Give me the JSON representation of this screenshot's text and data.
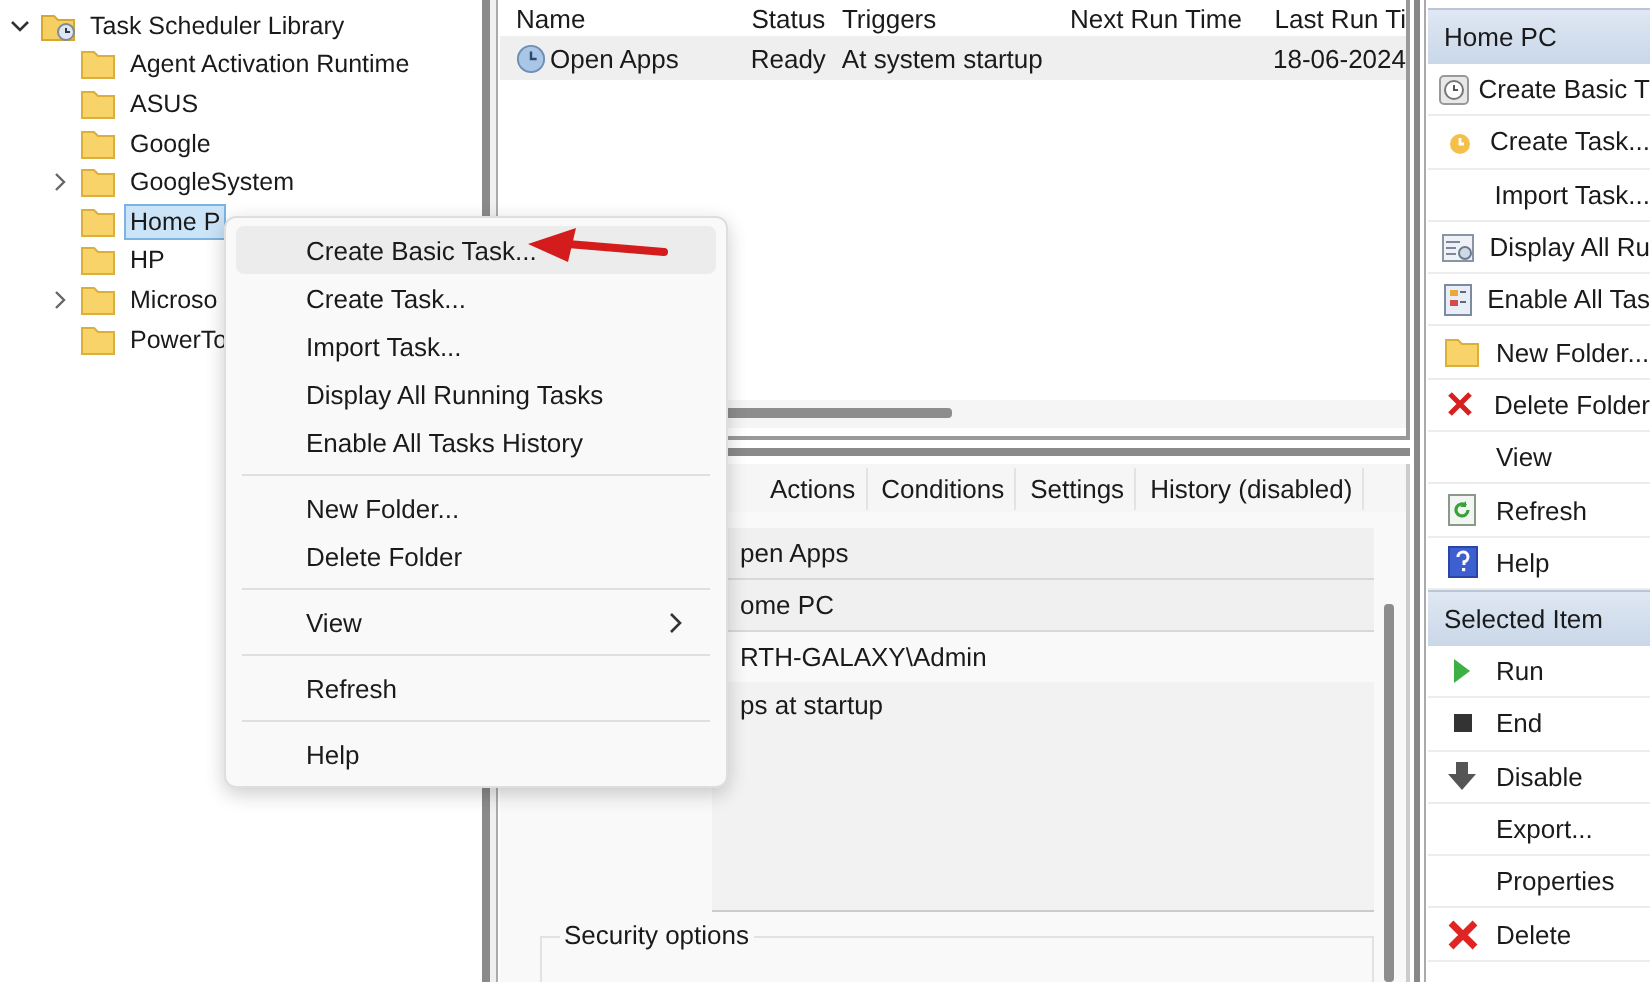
{
  "tree": {
    "label": "Task Scheduler Library",
    "expanded": true,
    "children": [
      {
        "label": "Agent Activation Runtime",
        "selected": false
      },
      {
        "label": "ASUS",
        "selected": false
      },
      {
        "label": "Google",
        "selected": false
      },
      {
        "label": "GoogleSystem",
        "selected": false,
        "expanded": false
      },
      {
        "label": "Home P",
        "selected": true
      },
      {
        "label": "HP",
        "selected": false
      },
      {
        "label": "Microso",
        "selected": false,
        "expanded": false
      },
      {
        "label": "PowerTo",
        "selected": false
      }
    ]
  },
  "task_list": {
    "columns": [
      "Name",
      "Status",
      "Triggers",
      "Next Run Time",
      "Last Run Ti"
    ],
    "rows": [
      {
        "cells": [
          "Open Apps",
          "Ready",
          "At system startup",
          "",
          "18-06-2024"
        ],
        "selected": true
      }
    ]
  },
  "details": {
    "tabs": [
      {
        "label": "Actions",
        "selected": false
      },
      {
        "label": "Conditions",
        "selected": false
      },
      {
        "label": "Settings",
        "selected": false
      },
      {
        "label": "History (disabled)",
        "selected": false
      }
    ],
    "name": "pen Apps",
    "location": "ome PC",
    "author": "RTH-GALAXY\\Admin",
    "description": "ps at startup",
    "security_group": "Security options"
  },
  "actions": {
    "sections": [
      {
        "title": "Home PC",
        "items": [
          "Create Basic T",
          "Create Task...",
          "Import Task...",
          "Display All Ru",
          "Enable All Tas",
          "New Folder...",
          "Delete Folder",
          "View",
          "Refresh",
          "Help"
        ]
      },
      {
        "title": "Selected Item",
        "items": [
          "Run",
          "End",
          "Disable",
          "Export...",
          "Properties",
          "Delete"
        ]
      }
    ]
  },
  "context_menu": {
    "items": [
      {
        "kind": "item",
        "label": "Create Basic Task...",
        "selected": true
      },
      {
        "kind": "item",
        "label": "Create Task...",
        "selected": false
      },
      {
        "kind": "item",
        "label": "Import Task...",
        "selected": false
      },
      {
        "kind": "item",
        "label": "Display All Running Tasks",
        "selected": false
      },
      {
        "kind": "item",
        "label": "Enable All Tasks History",
        "selected": false
      },
      {
        "kind": "separator"
      },
      {
        "kind": "item",
        "label": "New Folder...",
        "selected": false
      },
      {
        "kind": "item",
        "label": "Delete Folder",
        "selected": false
      },
      {
        "kind": "separator"
      },
      {
        "kind": "item",
        "label": "View",
        "selected": false,
        "submenu": true
      },
      {
        "kind": "separator"
      },
      {
        "kind": "item",
        "label": "Refresh",
        "selected": false
      },
      {
        "kind": "separator"
      },
      {
        "kind": "item",
        "label": "Help",
        "selected": false
      }
    ]
  }
}
